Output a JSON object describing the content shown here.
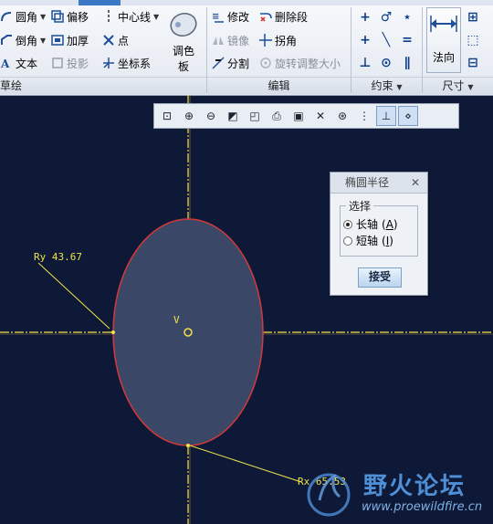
{
  "ribbon": {
    "sketch_group": {
      "items": [
        {
          "label": "圆角",
          "icon": "fillet-arc-icon",
          "dropdown": true
        },
        {
          "label": "偏移",
          "icon": "offset-icon"
        },
        {
          "label": "中心线",
          "icon": "centerline-icon",
          "dropdown": true
        },
        {
          "label": "倒角",
          "icon": "chamfer-icon",
          "dropdown": true
        },
        {
          "label": "加厚",
          "icon": "thicken-icon"
        },
        {
          "label": "点",
          "icon": "point-icon"
        },
        {
          "label": "文本",
          "icon": "text-icon"
        },
        {
          "label": "投影",
          "icon": "project-icon",
          "disabled": true
        },
        {
          "label": "坐标系",
          "icon": "coordinate-system-icon"
        }
      ],
      "palette_label_1": "调色",
      "palette_label_2": "板",
      "group_label": "草绘"
    },
    "edit_group": {
      "items": [
        {
          "label": "修改",
          "icon": "modify-icon"
        },
        {
          "label": "删除段",
          "icon": "delete-segment-icon"
        },
        {
          "label": "镜像",
          "icon": "mirror-icon",
          "disabled": true
        },
        {
          "label": "拐角",
          "icon": "corner-icon"
        },
        {
          "label": "分割",
          "icon": "divide-icon"
        },
        {
          "label": "旋转调整大小",
          "icon": "rotate-resize-icon",
          "disabled": true
        }
      ],
      "group_label": "编辑"
    },
    "constraint_group": {
      "group_label": "约束"
    },
    "dimension_group": {
      "big_button_label": "法向",
      "group_label": "尺寸"
    }
  },
  "dialog": {
    "title": "椭圆半径",
    "section_label": "选择",
    "options": [
      {
        "label": "长轴",
        "mnemonic": "A",
        "selected": true
      },
      {
        "label": "短轴",
        "mnemonic": "I",
        "selected": false
      }
    ],
    "accept_label": "接受"
  },
  "canvas": {
    "dim_ry": "Ry 43.67",
    "dim_rx": "Rx 65.53",
    "vertex_label": "V"
  },
  "watermark": {
    "title": "野火论坛",
    "url": "www.proewildfire.cn"
  },
  "colors": {
    "canvas_bg": "#0e1938",
    "ellipse_edge": "#d43a3a",
    "ellipse_fill": "#3a4766",
    "centerline": "#f3e34a",
    "dimension": "#f3e34a"
  }
}
